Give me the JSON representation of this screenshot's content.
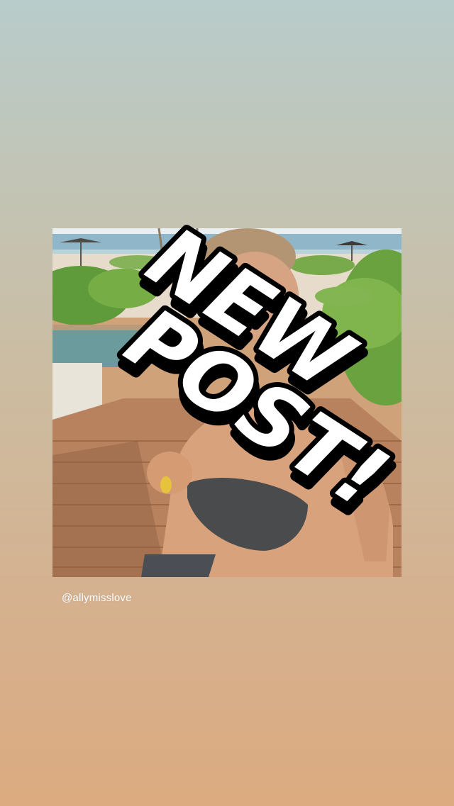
{
  "story": {
    "sticker_line_1": "NEW",
    "sticker_line_2": "POST!",
    "mention": "@allymisslove",
    "colors": {
      "gradient_top": "#b8cccb",
      "gradient_bottom": "#dcab80",
      "sticker_fill": "#ffffff",
      "sticker_outline": "#000000"
    },
    "icons": {
      "post_image": "beach-selfie-photo",
      "sticker": "new-post-sticker"
    }
  }
}
